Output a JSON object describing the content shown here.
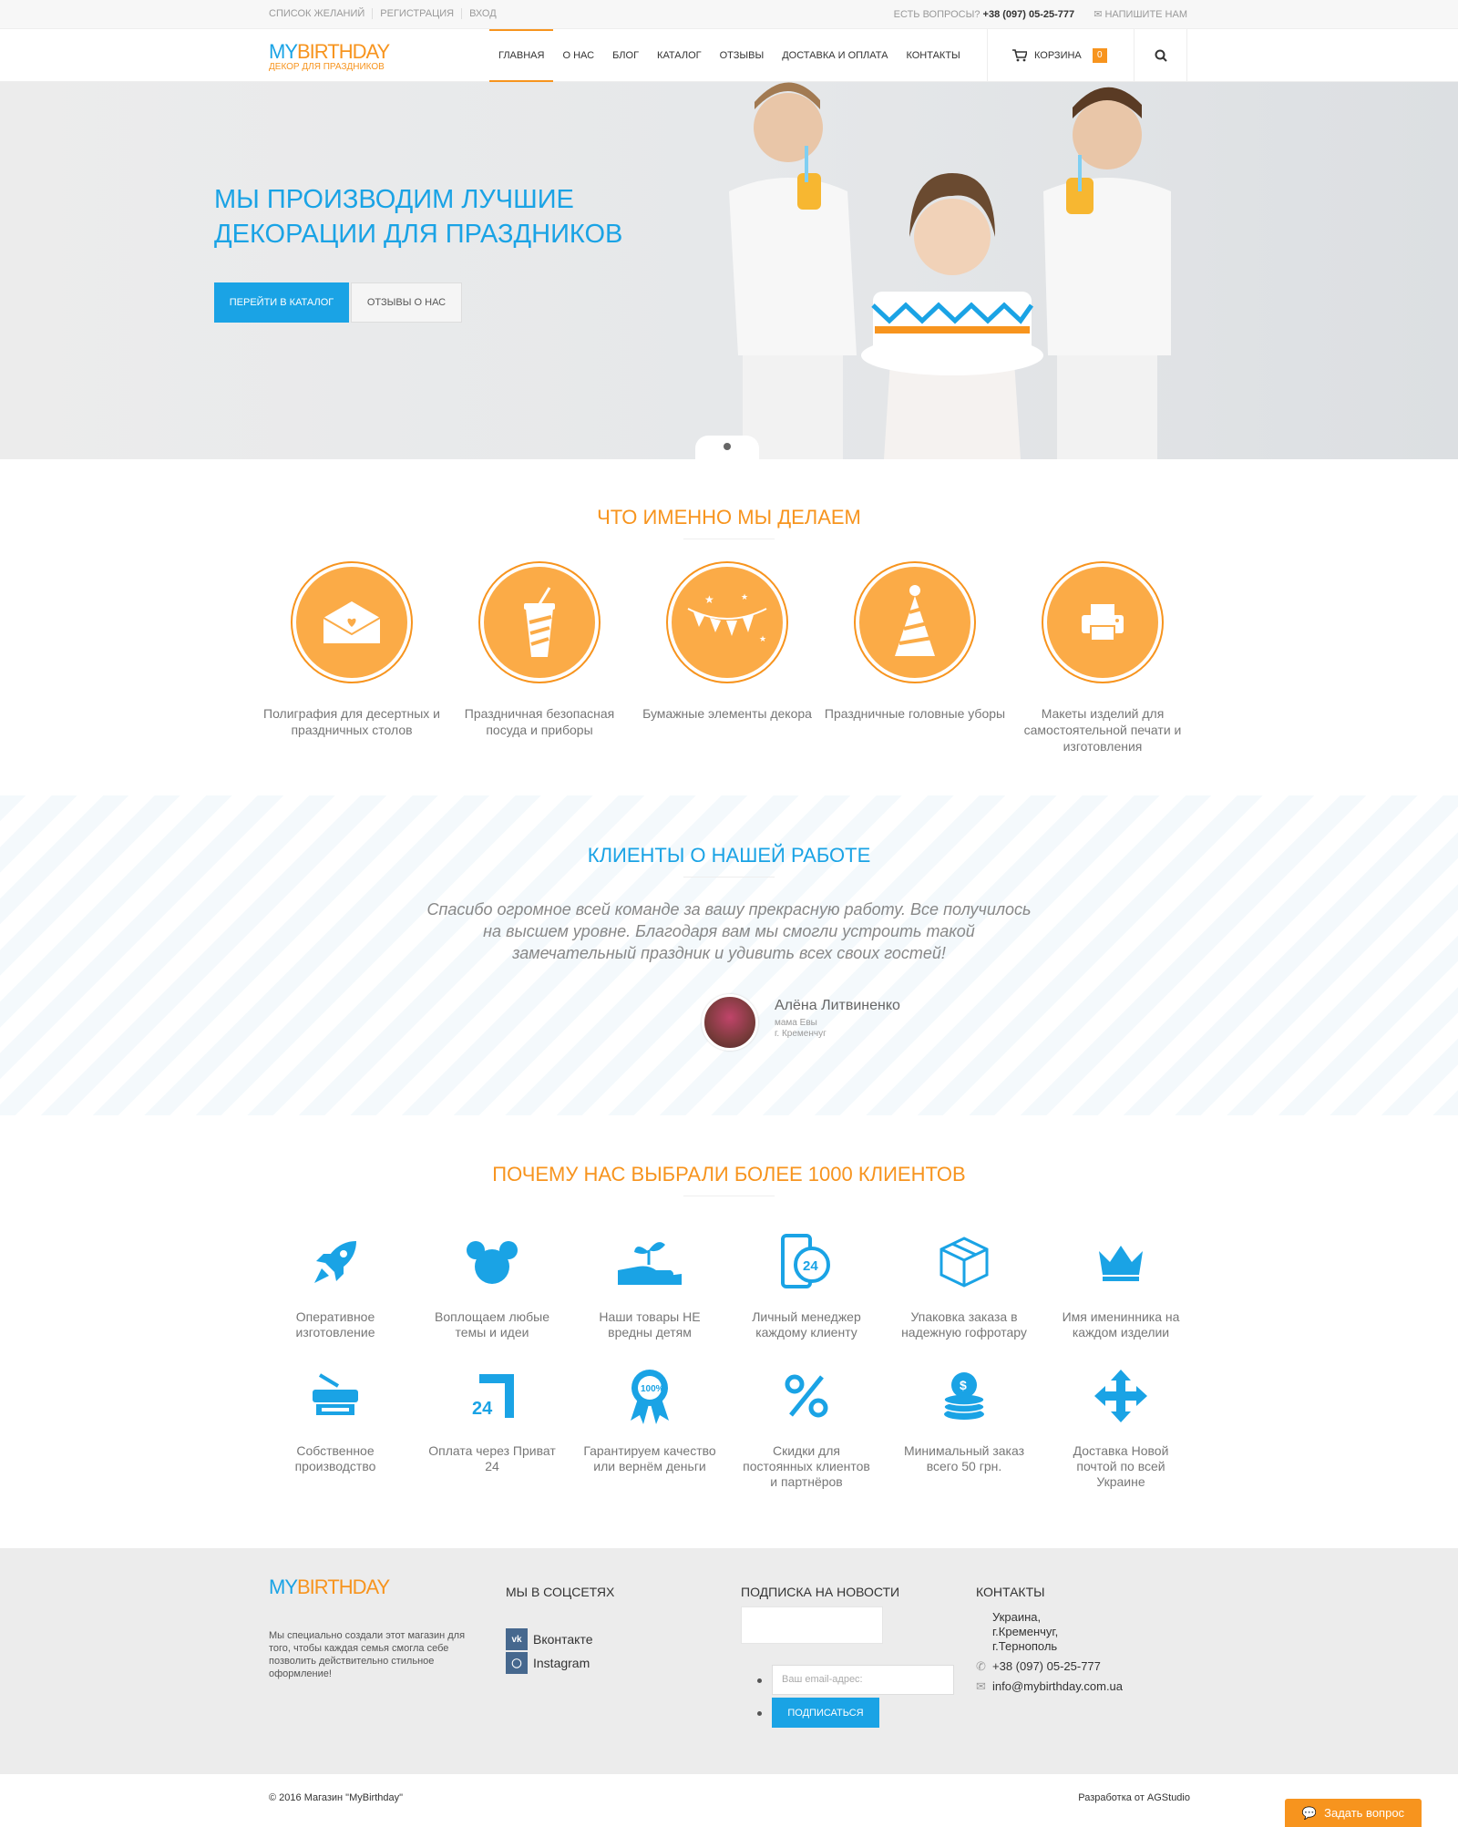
{
  "topbar": {
    "links": [
      "СПИСОК ЖЕЛАНИЙ",
      "РЕГИСТРАЦИЯ",
      "ВХОД"
    ],
    "question_label": "ЕСТЬ ВОПРОСЫ?",
    "phone": "+38 (097) 05-25-777",
    "write_label": "НАПИШИТЕ НАМ"
  },
  "header": {
    "logo_my": "MY",
    "logo_birthday": "BIRTHDAY",
    "logo_tagline": "ДЕКОР ДЛЯ ПРАЗДНИКОВ",
    "nav": [
      "ГЛАВНАЯ",
      "О НАС",
      "БЛОГ",
      "КАТАЛОГ",
      "ОТЗЫВЫ",
      "ДОСТАВКА И ОПЛАТА",
      "КОНТАКТЫ"
    ],
    "cart_label": "КОРЗИНА",
    "cart_count": "0"
  },
  "hero": {
    "title": "МЫ ПРОИЗВОДИМ ЛУЧШИЕ ДЕКОРАЦИИ ДЛЯ ПРАЗДНИКОВ",
    "btn_catalog": "ПЕРЕЙТИ В КАТАЛОГ",
    "btn_reviews": "ОТЗЫВЫ О НАС"
  },
  "services": {
    "title": "ЧТО ИМЕННО МЫ ДЕЛАЕМ",
    "items": [
      {
        "label": "Полиграфия для десертных и праздничных столов",
        "icon": "envelope-heart-icon"
      },
      {
        "label": "Праздничная безопасная посуда и приборы",
        "icon": "drink-cup-icon"
      },
      {
        "label": "Бумажные элементы декора",
        "icon": "bunting-flags-icon"
      },
      {
        "label": "Праздничные головные уборы",
        "icon": "party-hat-icon"
      },
      {
        "label": "Макеты изделий для самостоятельной печати и изготовления",
        "icon": "printer-icon"
      }
    ]
  },
  "testimonial": {
    "title": "КЛИЕНТЫ О НАШЕЙ РАБОТЕ",
    "quote": "Спасибо огромное всей команде за вашу прекрасную работу. Все получилось на высшем уровне. Благодаря вам мы смогли устроить такой замечательный праздник и удивить всех своих гостей!",
    "author": "Алёна Литвиненко",
    "role": "мама Евы",
    "city": "г. Кременчуг"
  },
  "features": {
    "title": "ПОЧЕМУ НАС ВЫБРАЛИ БОЛЕЕ 1000 КЛИЕНТОВ",
    "items": [
      {
        "label": "Оперативное изготовление",
        "icon": "rocket-icon"
      },
      {
        "label": "Воплощаем любые темы и идеи",
        "icon": "mouse-ears-icon"
      },
      {
        "label": "Наши товары НЕ вредны детям",
        "icon": "hand-plant-icon"
      },
      {
        "label": "Личный менеджер каждому клиенту",
        "icon": "phone-24-icon"
      },
      {
        "label": "Упаковка заказа в надежную гофротару",
        "icon": "box-icon"
      },
      {
        "label": "Имя именинника на каждом изделии",
        "icon": "crown-icon"
      },
      {
        "label": "Собственное производство",
        "icon": "scanner-icon"
      },
      {
        "label": "Оплата через Приват 24",
        "icon": "privat24-icon"
      },
      {
        "label": "Гарантируем качество или вернём деньги",
        "icon": "badge-100-icon"
      },
      {
        "label": "Скидки для постоянных клиентов и партнёров",
        "icon": "percent-icon"
      },
      {
        "label": "Минимальный заказ всего 50 грн.",
        "icon": "coins-icon"
      },
      {
        "label": "Доставка Новой почтой по всей Украине",
        "icon": "nova-poshta-icon"
      }
    ]
  },
  "footer": {
    "logo_my": "MY",
    "logo_birthday": "BIRTHDAY",
    "description": "Мы специально создали этот магазин для того, чтобы каждая семья смогла себе позволить действительно стильное оформление!",
    "social_title": "МЫ В СОЦСЕТЯХ",
    "vk": "Вконтакте",
    "instagram": "Instagram",
    "newsletter_title": "ПОДПИСКА НА НОВОСТИ",
    "email_placeholder": "Ваш email-адрес:",
    "subscribe": "ПОДПИСАТЬСЯ",
    "contacts_title": "КОНТАКТЫ",
    "address1": "Украина,",
    "address2": "г.Кременчуг,",
    "address3": "г.Тернополь",
    "phone": "+38 (097) 05-25-777",
    "email": "info@mybirthday.com.ua",
    "copyright": "© 2016 Магазин \"MyBirthday\"",
    "developer": "Разработка от AGStudio",
    "ask": "Задать вопрос"
  },
  "colors": {
    "accent_orange": "#f7941e",
    "accent_blue": "#1aa3e5"
  }
}
